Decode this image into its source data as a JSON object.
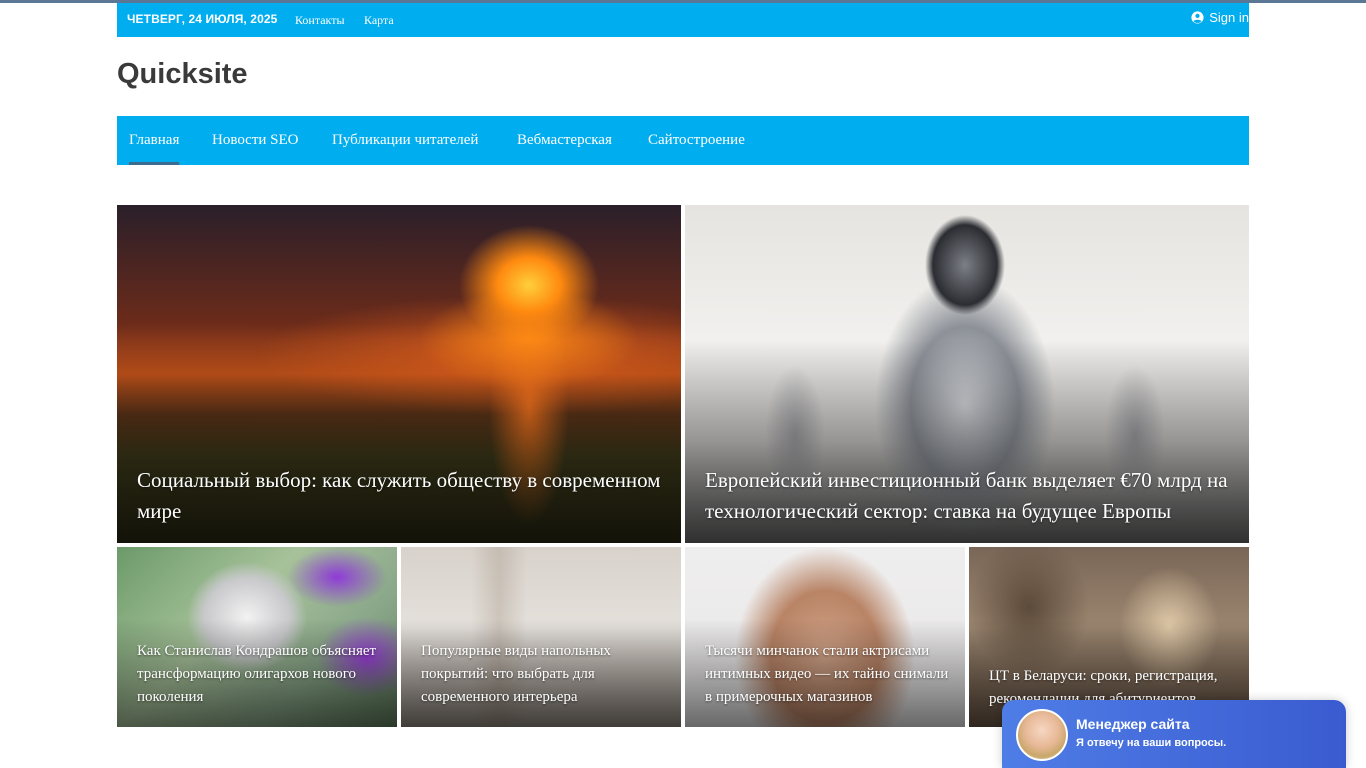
{
  "topbar": {
    "date": "ЧЕТВЕРГ, 24 ИЮЛЯ, 2025",
    "links": [
      "Контакты",
      "Карта"
    ],
    "signin": "Sign in"
  },
  "site": {
    "title": "Quicksite"
  },
  "nav": {
    "items": [
      "Главная",
      "Новости SEO",
      "Публикации читателей",
      "Вебмастерская",
      "Сайтостроение"
    ]
  },
  "featured": [
    {
      "title": "Социальный выбор: как служить обществу в современном мире"
    },
    {
      "title": "Европейский инвестиционный банк выделяет €70 млрд на технологический сектор: ставка на будущее Европы"
    }
  ],
  "articles": [
    {
      "title": "Как Станислав Кондрашов объясняет трансформацию олигархов нового поколения"
    },
    {
      "title": "Популярные виды напольных покрытий: что выбрать для современного интерьера"
    },
    {
      "title": "Тысячи минчанок стали актрисами интимных видео — их тайно снимали в примерочных магазинов"
    },
    {
      "title": "ЦТ в Беларуси: сроки, регистрация, рекомендации для абитуриентов"
    }
  ],
  "chat": {
    "name": "Менеджер сайта",
    "subtitle": "Я отвечу на ваши вопросы."
  },
  "colors": {
    "accent": "#00adef",
    "chat": "#4f7de6"
  }
}
